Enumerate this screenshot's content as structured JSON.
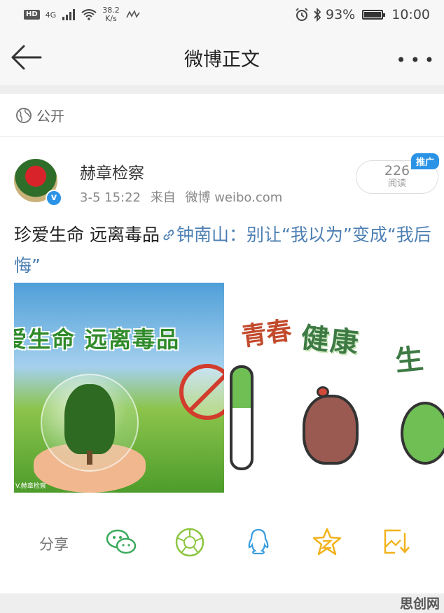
{
  "status_bar": {
    "network": "4G",
    "hd_label": "HD",
    "speed_value": "38.2",
    "speed_unit": "K/s",
    "battery_percent": "93%",
    "battery_level": 0.93,
    "time": "10:00"
  },
  "nav": {
    "title": "微博正文",
    "more": "•••"
  },
  "visibility": {
    "label": "公开"
  },
  "post": {
    "author": "赫章检察",
    "time": "3-5 15:22",
    "source_prefix": "来自",
    "source": "微博 weibo.com",
    "reads_count": "226",
    "reads_label": "阅读",
    "promo_badge": "推广",
    "text_main": "珍爱生命  远离毒品",
    "text_link": "钟南山：别让“我以为”变成“我后悔”"
  },
  "images": {
    "image1_slogan": "爱生命  远离毒品",
    "image1_credit": "V.赫章检察",
    "image2_text_1": "青春",
    "image2_text_2": "健康",
    "image2_text_3": "生"
  },
  "share": {
    "label": "分享",
    "icons": [
      "wechat-icon",
      "moments-icon",
      "qq-icon",
      "qzone-icon",
      "save-image-icon"
    ]
  },
  "watermark": "思创网"
}
